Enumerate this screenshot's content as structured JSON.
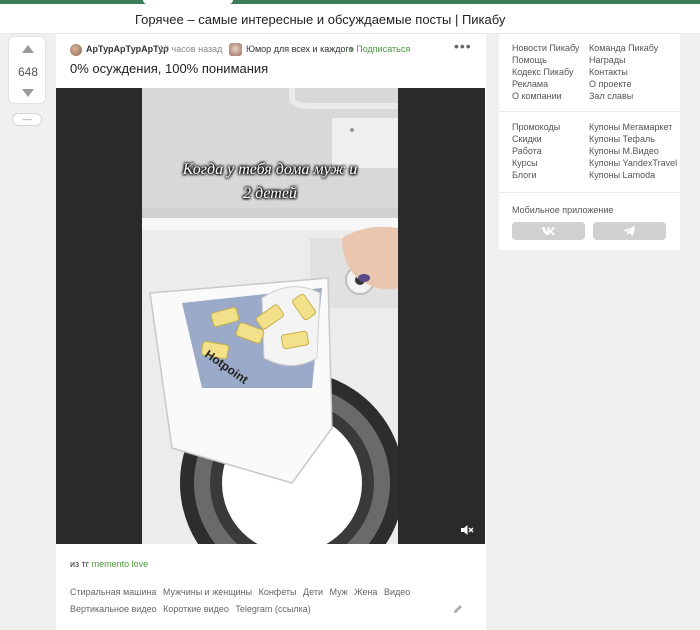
{
  "page": {
    "title": "Горячее – самые интересные и обсуждаемые посты | Пикабу"
  },
  "rating": {
    "count": "648",
    "more_label": "—"
  },
  "story": {
    "author": "АрТурАрТурАрТур",
    "time": "10 часов назад",
    "community": "Юмор для всех и каждого",
    "subscribe_label": "Подписаться",
    "title": "0% осуждения, 100% понимания",
    "video_caption": "Когда у тебя дома муж и 2 детей",
    "video_brand": "Hotpoint",
    "source_prefix": "из тг",
    "source_link": "memento love",
    "tags": [
      "Стиральная машина",
      "Мужчины и женщины",
      "Конфеты",
      "Дети",
      "Муж",
      "Жена",
      "Видео",
      "Вертикальное видео",
      "Короткие видео",
      "Telegram (ссылка)"
    ]
  },
  "sidebar": {
    "links_col1": [
      "Новости Пикабу",
      "Помощь",
      "Кодекс Пикабу",
      "Реклама",
      "О компании"
    ],
    "links_col2": [
      "Команда Пикабу",
      "Награды",
      "Контакты",
      "О проекте",
      "Зал славы"
    ],
    "promo_col1": [
      "Промокоды",
      "Скидки",
      "Работа",
      "Курсы",
      "Блоги"
    ],
    "promo_col2": [
      "Купоны Мегамаркет",
      "Купоны Тефаль",
      "Купоны М.Видео",
      "Купоны YandexTravel",
      "Купоны Lamoda"
    ],
    "mobile_app_label": "Мобильное приложение"
  },
  "icons": [
    "vote-up-icon",
    "vote-down-icon",
    "menu-dots-icon",
    "plus-icon",
    "mute-icon",
    "pencil-icon",
    "vk-icon",
    "telegram-icon"
  ],
  "colors": {
    "accent_green": "#4a9a3c",
    "topbar_green": "#3c7d57"
  }
}
